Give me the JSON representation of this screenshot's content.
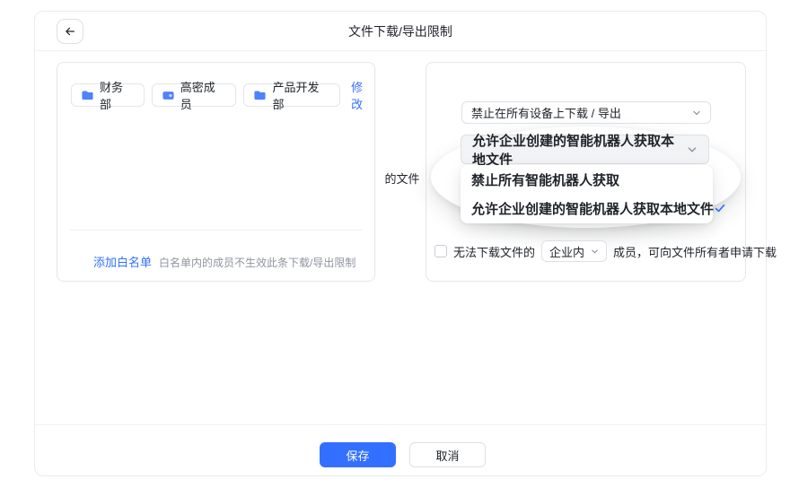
{
  "dialog": {
    "title": "文件下载/导出限制",
    "back_icon": "arrow-left-icon"
  },
  "scope": {
    "chips": [
      {
        "label": "财务部",
        "icon": "folder-icon"
      },
      {
        "label": "高密成员",
        "icon": "badge-icon"
      },
      {
        "label": "产品开发部",
        "icon": "folder-icon"
      }
    ],
    "modify_label": "修改",
    "whitelist_link": "添加白名单",
    "whitelist_hint": "白名单内的成员不生效此条下载/导出限制"
  },
  "connector_label": "的文件",
  "restrictions": {
    "device_select_value": "禁止在所有设备上下载 / 导出",
    "bot_select_value": "允许企业创建的智能机器人获取本地文件",
    "bot_options": [
      {
        "label": "禁止所有智能机器人获取",
        "selected": false
      },
      {
        "label": "允许企业创建的智能机器人获取本地文件",
        "selected": true
      }
    ],
    "request_row": {
      "checkbox_checked": false,
      "prefix": "无法下载文件的",
      "member_scope_value": "企业内",
      "suffix": "成员，可向文件所有者申请下载"
    }
  },
  "footer": {
    "save_label": "保存",
    "cancel_label": "取消"
  },
  "colors": {
    "accent": "#3370ff",
    "icon_blue": "#4e83fd",
    "text": "#1f2329",
    "muted": "#8f959e",
    "border": "#dee0e3"
  }
}
